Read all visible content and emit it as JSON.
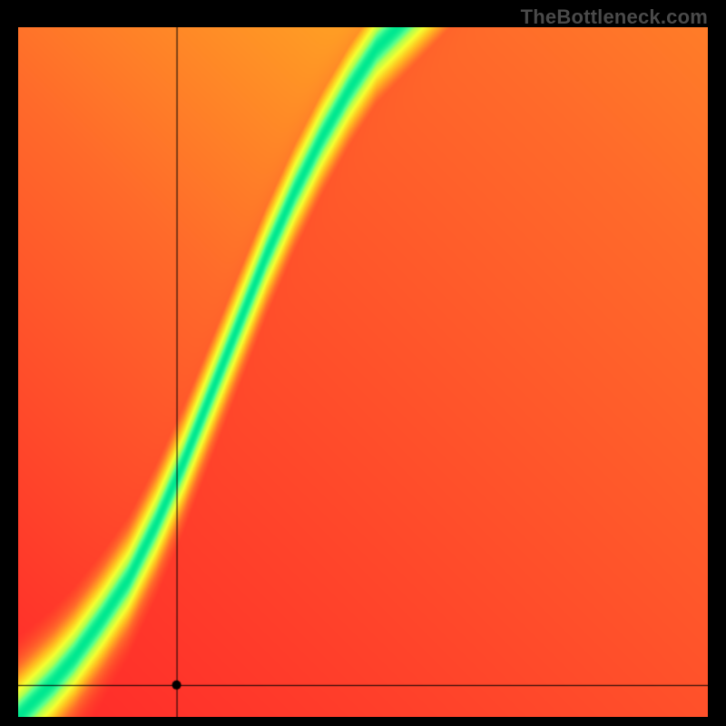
{
  "watermark": "TheBottleneck.com",
  "chart_data": {
    "type": "heatmap",
    "title": "",
    "xlabel": "",
    "ylabel": "",
    "xlim": [
      0,
      1
    ],
    "ylim": [
      0,
      1
    ],
    "crosshair": {
      "x": 0.23,
      "y": 0.045
    },
    "ideal_curve": [
      [
        0.0,
        0.0
      ],
      [
        0.02,
        0.02
      ],
      [
        0.05,
        0.05
      ],
      [
        0.08,
        0.085
      ],
      [
        0.12,
        0.14
      ],
      [
        0.16,
        0.2
      ],
      [
        0.2,
        0.28
      ],
      [
        0.24,
        0.37
      ],
      [
        0.28,
        0.47
      ],
      [
        0.32,
        0.57
      ],
      [
        0.36,
        0.67
      ],
      [
        0.4,
        0.76
      ],
      [
        0.44,
        0.84
      ],
      [
        0.48,
        0.91
      ],
      [
        0.52,
        0.97
      ],
      [
        0.55,
        1.0
      ]
    ],
    "colormap": [
      [
        0.0,
        "#ff2a2a"
      ],
      [
        0.25,
        "#ff6a2a"
      ],
      [
        0.5,
        "#ffc020"
      ],
      [
        0.7,
        "#f6ff30"
      ],
      [
        0.85,
        "#b0ff50"
      ],
      [
        0.93,
        "#50ff90"
      ],
      [
        1.0,
        "#00e890"
      ]
    ],
    "curve_bandwidth": 0.045,
    "ambient_weight_upper_right": 0.55
  }
}
